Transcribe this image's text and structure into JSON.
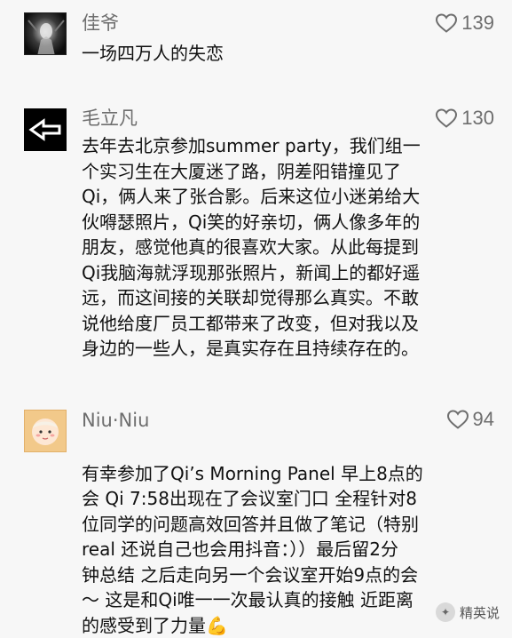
{
  "comments": [
    {
      "username": "佳爷",
      "likes": "139",
      "text": "一场四万人的失恋",
      "avatar_icon": "shadow-figure-avatar"
    },
    {
      "username": "毛立凡",
      "likes": "130",
      "text": "去年去北京参加summer party，我们组一\n个实习生在大厦迷了路，阴差阳错撞见了\nQi，俩人来了张合影。后来这位小迷弟给大\n伙嘚瑟照片，Qi笑的好亲切，俩人像多年的\n朋友，感觉他真的很喜欢大家。从此每提到\nQi我脑海就浮现那张照片，新闻上的都好遥\n远，而这间接的关联却觉得那么真实。不敢\n说他给度厂员工都带来了改变，但对我以及\n身边的一些人，是真实存在且持续存在的。",
      "avatar_icon": "left-arrow-avatar"
    },
    {
      "username": "Niu·Niu",
      "likes": "94",
      "text": "有幸参加了Qi’s Morning Panel  早上8点的\n会 Qi 7:58出现在了会议室门口 全程针对8\n位同学的问题高效回答并且做了笔记（特别\nreal 还说自己也会用抖音：））最后留2分\n钟总结 之后走向另一个会议室开始9点的会\n～ 这是和Qi唯一一次最认真的接触  近距离\n的感受到了力量",
      "emoji": "💪",
      "avatar_icon": "cartoon-baby-avatar"
    }
  ],
  "watermark": {
    "text": "精英说",
    "icon": "wechat-account-icon"
  },
  "colors": {
    "background": "#f7f7f7",
    "username": "#6e6e6e",
    "body_text": "#111111",
    "heart_outline": "#6e6e6e"
  }
}
